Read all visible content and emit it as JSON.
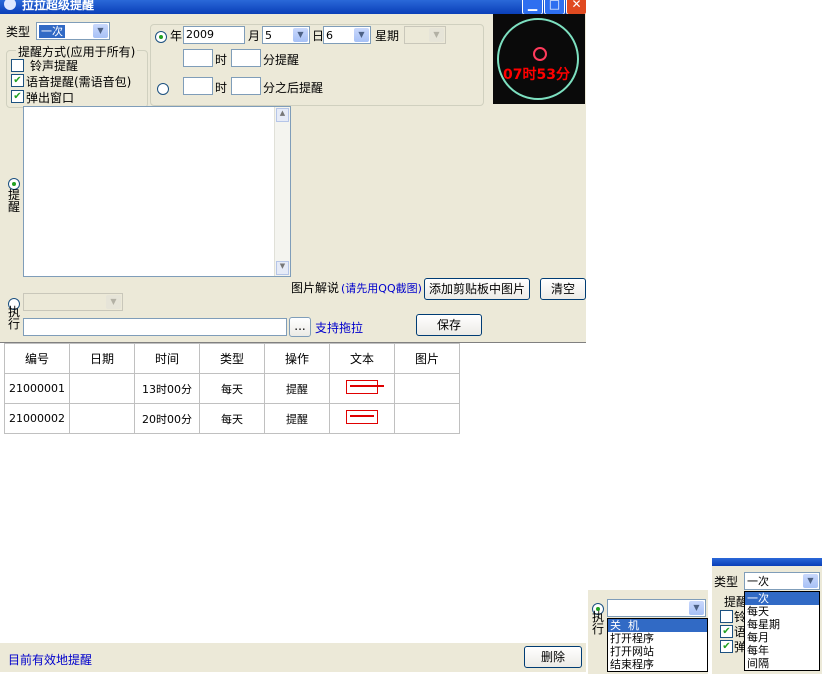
{
  "window": {
    "title": "拉拉超级提醒"
  },
  "type_row": {
    "label": "类型",
    "selected": "一次"
  },
  "remind_mode": {
    "legend": "提醒方式(应用于所有)",
    "options": [
      {
        "label": "铃声提醒",
        "checked": false
      },
      {
        "label": "语音提醒(需语音包)",
        "checked": true
      },
      {
        "label": "弹出窗口",
        "checked": true
      }
    ]
  },
  "date_row": {
    "year_label": "年",
    "year_value": "2009",
    "month_label": "月",
    "month_value": "5",
    "day_label": "日",
    "day_value": "6",
    "week_label": "星期"
  },
  "time_row": {
    "hour_label": "时",
    "minute_label": "分提醒"
  },
  "after_row": {
    "hour_label": "时",
    "minute_label": "分之后提醒"
  },
  "clock": {
    "text": "07时53分",
    "accent": "#ff0000"
  },
  "remind_label": "提醒",
  "execute_label": "执行",
  "image_caption": {
    "text": "图片解说",
    "hint": "(请先用QQ截图)"
  },
  "buttons": {
    "paste_image": "添加剪贴板中图片",
    "clear": "清空",
    "browse": "...",
    "save": "保存",
    "delete": "删除"
  },
  "drag_support": "支持拖拉",
  "table": {
    "headers": [
      "编号",
      "日期",
      "时间",
      "类型",
      "操作",
      "文本",
      "图片"
    ],
    "rows": [
      [
        "21000001",
        "",
        "13时00分",
        "每天",
        "提醒",
        "",
        ""
      ],
      [
        "21000002",
        "",
        "20时00分",
        "每天",
        "提醒",
        "",
        ""
      ]
    ]
  },
  "status": "目前有效地提醒",
  "exec_dropdown": {
    "label": "执行",
    "items": [
      "关  机",
      "打开程序",
      "打开网站",
      "结束程序"
    ],
    "selected_index": 0
  },
  "type_dropdown": {
    "label": "类型",
    "value": "一次",
    "items": [
      "一次",
      "每天",
      "每星期",
      "每月",
      "每年",
      "间隔"
    ],
    "selected_index": 0,
    "partial_labels": [
      "提醒",
      "铃",
      "语",
      "弹"
    ]
  }
}
